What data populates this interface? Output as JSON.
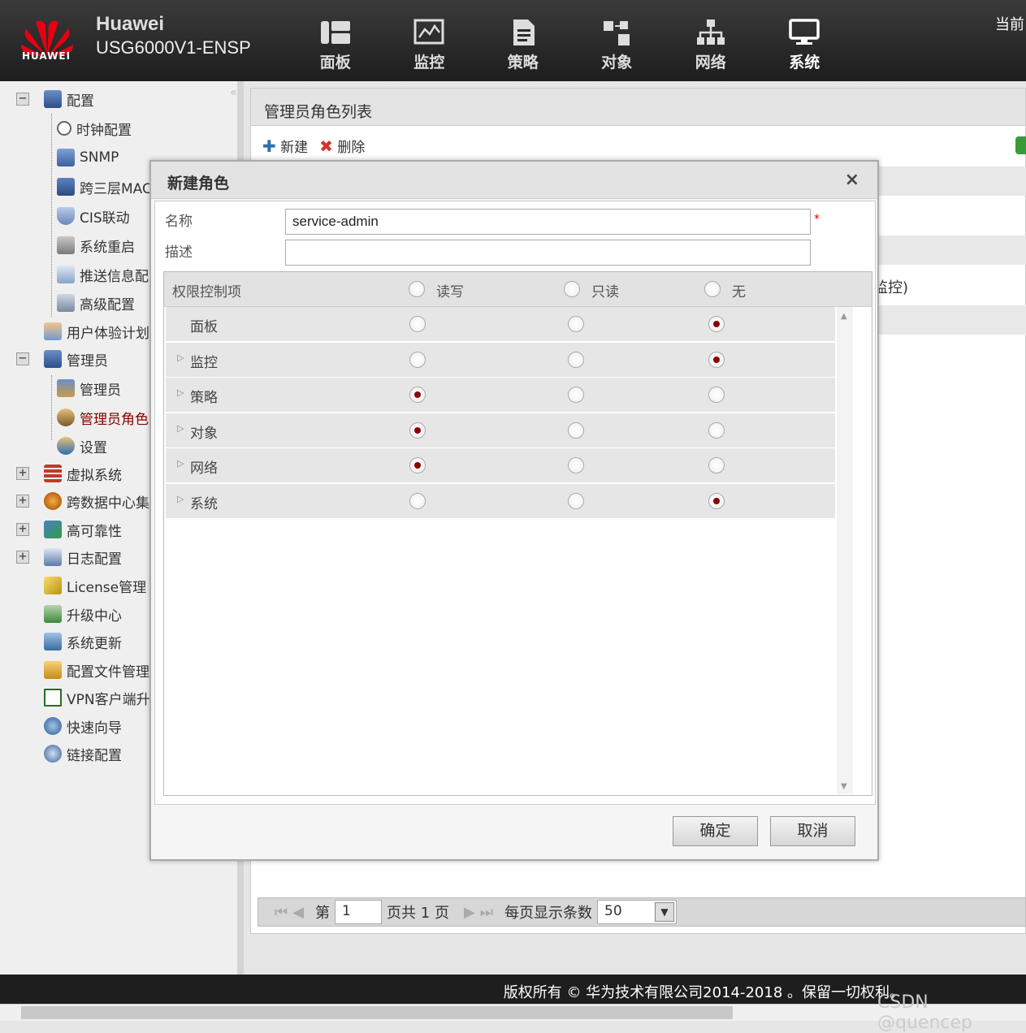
{
  "header": {
    "brand": "Huawei",
    "model": "USG6000V1-ENSP",
    "logo_text": "HUAWEI",
    "current": "当前",
    "nav": [
      {
        "label": "面板",
        "icon": "dashboard-icon"
      },
      {
        "label": "监控",
        "icon": "monitor-chart-icon"
      },
      {
        "label": "策略",
        "icon": "policy-document-icon"
      },
      {
        "label": "对象",
        "icon": "object-blocks-icon"
      },
      {
        "label": "网络",
        "icon": "network-topology-icon"
      },
      {
        "label": "系统",
        "icon": "system-display-icon"
      }
    ]
  },
  "sidebar": {
    "collapse_icon": "«",
    "items": [
      {
        "label": "配置",
        "icon": "config-computer-icon",
        "expander": "−"
      },
      {
        "label": "时钟配置",
        "icon": "clock-icon"
      },
      {
        "label": "SNMP",
        "icon": "snmp-network-icon"
      },
      {
        "label": "跨三层MAC",
        "icon": "mac-computer-icon"
      },
      {
        "label": "CIS联动",
        "icon": "cis-shield-icon"
      },
      {
        "label": "系统重启",
        "icon": "restart-icon"
      },
      {
        "label": "推送信息配",
        "icon": "push-message-icon"
      },
      {
        "label": "高级配置",
        "icon": "advanced-config-icon"
      },
      {
        "label": "用户体验计划",
        "icon": "user-experience-icon"
      },
      {
        "label": "管理员",
        "icon": "admin-icon",
        "expander": "−"
      },
      {
        "label": "管理员",
        "icon": "admin-user-icon"
      },
      {
        "label": "管理员角色",
        "icon": "admin-role-icon"
      },
      {
        "label": "设置",
        "icon": "settings-user-icon"
      },
      {
        "label": "虚拟系统",
        "icon": "virtual-system-icon",
        "expander": "+"
      },
      {
        "label": "跨数据中心集",
        "icon": "datacenter-icon",
        "expander": "+"
      },
      {
        "label": "高可靠性",
        "icon": "high-availability-icon",
        "expander": "+"
      },
      {
        "label": "日志配置",
        "icon": "log-config-icon",
        "expander": "+"
      },
      {
        "label": "License管理",
        "icon": "license-key-icon"
      },
      {
        "label": "升级中心",
        "icon": "upgrade-center-icon"
      },
      {
        "label": "系统更新",
        "icon": "system-update-icon"
      },
      {
        "label": "配置文件管理",
        "icon": "config-file-icon"
      },
      {
        "label": "VPN客户端升",
        "icon": "vpn-client-icon"
      },
      {
        "label": "快速向导",
        "icon": "quick-wizard-icon"
      },
      {
        "label": "链接配置",
        "icon": "link-config-icon"
      }
    ]
  },
  "main": {
    "title": "管理员角色列表",
    "new_label": "新建",
    "delete_label": "删除",
    "cell_text": "监控)"
  },
  "pager": {
    "page_prefix": "第",
    "page_value": "1",
    "page_suffix": "页共 1 页",
    "per_page_label": "每页显示条数",
    "per_page_value": "50"
  },
  "footer": {
    "copyright": "版权所有 © 华为技术有限公司2014-2018 。保留一切权利。"
  },
  "watermark": "CSDN @quencep",
  "dialog": {
    "title": "新建角色",
    "close": "×",
    "name_label": "名称",
    "name_value": "service-admin",
    "required_mark": "*",
    "desc_label": "描述",
    "desc_value": "",
    "perm_header": "权限控制项",
    "columns": [
      "读写",
      "只读",
      "无"
    ],
    "rows": [
      {
        "label": "面板",
        "selected": "无",
        "expandable": false
      },
      {
        "label": "监控",
        "selected": "无",
        "expandable": true
      },
      {
        "label": "策略",
        "selected": "读写",
        "expandable": true
      },
      {
        "label": "对象",
        "selected": "读写",
        "expandable": true
      },
      {
        "label": "网络",
        "selected": "读写",
        "expandable": true
      },
      {
        "label": "系统",
        "selected": "无",
        "expandable": true
      }
    ],
    "ok_label": "确定",
    "cancel_label": "取消"
  },
  "colors": {
    "accent": "#8b0000",
    "header_bg": "#2a2a2a",
    "huawei_red": "#e60012"
  }
}
